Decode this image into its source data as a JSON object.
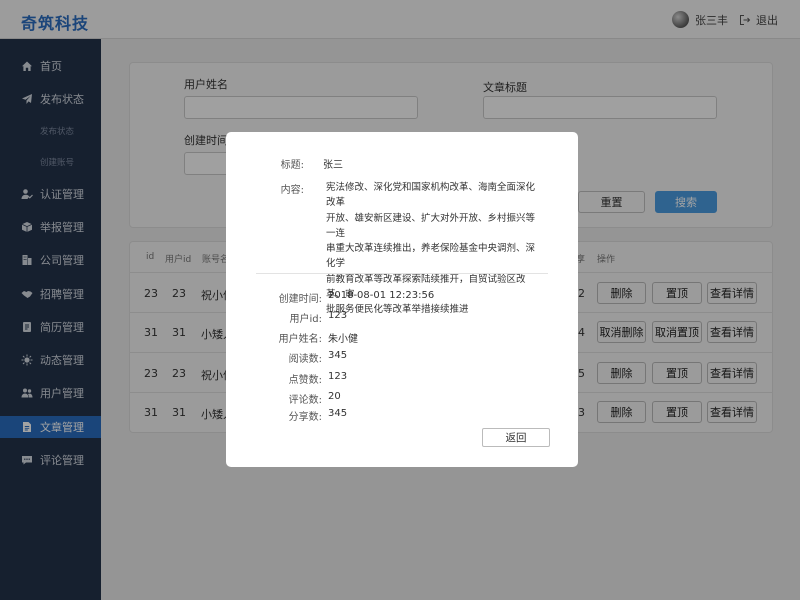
{
  "header": {
    "logo": "奇筑科技",
    "user_name": "张三丰",
    "logout_label": "退出"
  },
  "sidebar": {
    "items": [
      {
        "label": "首页",
        "icon": "home-icon"
      },
      {
        "label": "发布状态",
        "icon": "paper-plane-icon"
      },
      {
        "label": "发布状态",
        "icon": ""
      },
      {
        "label": "创建账号",
        "icon": ""
      },
      {
        "label": "认证管理",
        "icon": "user-check-icon"
      },
      {
        "label": "举报管理",
        "icon": "box-icon"
      },
      {
        "label": "公司管理",
        "icon": "building-icon"
      },
      {
        "label": "招聘管理",
        "icon": "handshake-icon"
      },
      {
        "label": "简历管理",
        "icon": "resume-icon"
      },
      {
        "label": "动态管理",
        "icon": "sun-icon"
      },
      {
        "label": "用户管理",
        "icon": "users-icon"
      },
      {
        "label": "文章管理",
        "icon": "document-icon"
      },
      {
        "label": "评论管理",
        "icon": "comment-icon"
      }
    ]
  },
  "search": {
    "user_name_label": "用户姓名",
    "article_title_label": "文章标题",
    "created_time_label": "创建时间",
    "reset_label": "重置",
    "search_label": "搜索"
  },
  "table": {
    "headers": [
      "id",
      "用户id",
      "账号名",
      "享",
      "操作"
    ],
    "rows": [
      {
        "id": "23",
        "uid": "23",
        "name": "祝小件",
        "share": "2",
        "actions": [
          "删除",
          "置顶",
          "查看详情"
        ]
      },
      {
        "id": "31",
        "uid": "31",
        "name": "小矮人",
        "share": "4",
        "actions": [
          "取消删除",
          "取消置顶",
          "查看详情"
        ]
      },
      {
        "id": "23",
        "uid": "23",
        "name": "祝小件",
        "share": "5",
        "actions": [
          "删除",
          "置顶",
          "查看详情"
        ]
      },
      {
        "id": "31",
        "uid": "31",
        "name": "小矮人",
        "share": "3",
        "actions": [
          "删除",
          "置顶",
          "查看详情"
        ]
      }
    ]
  },
  "modal": {
    "title_label": "标题:",
    "title_value": "张三",
    "content_label": "内容:",
    "content_lines": [
      "宪法修改、深化党和国家机构改革、海南全面深化改革",
      "开放、雄安新区建设、扩大对外开放、乡村振兴等一连",
      "串重大改革连续推出，养老保险基金中央调剂、深化学",
      "前教育改革等改革探索陆续推开，自贸试验区改革、审",
      "批服务便民化等改革举措接续推进"
    ],
    "fields": [
      {
        "label": "创建时间:",
        "value": "2018-08-01 12:23:56"
      },
      {
        "label": "用户id:",
        "value": "123"
      },
      {
        "label": "用户姓名:",
        "value": "朱小健"
      },
      {
        "label": "阅读数:",
        "value": "345"
      },
      {
        "label": "点赞数:",
        "value": "123"
      },
      {
        "label": "评论数:",
        "value": "20"
      },
      {
        "label": "分享数:",
        "value": "345"
      }
    ],
    "back_label": "返回"
  },
  "colors": {
    "brand": "#2b6dbf",
    "sidebar_bg": "#23324a",
    "sidebar_active": "#2a6dbf",
    "primary_button": "#4a9be0"
  }
}
